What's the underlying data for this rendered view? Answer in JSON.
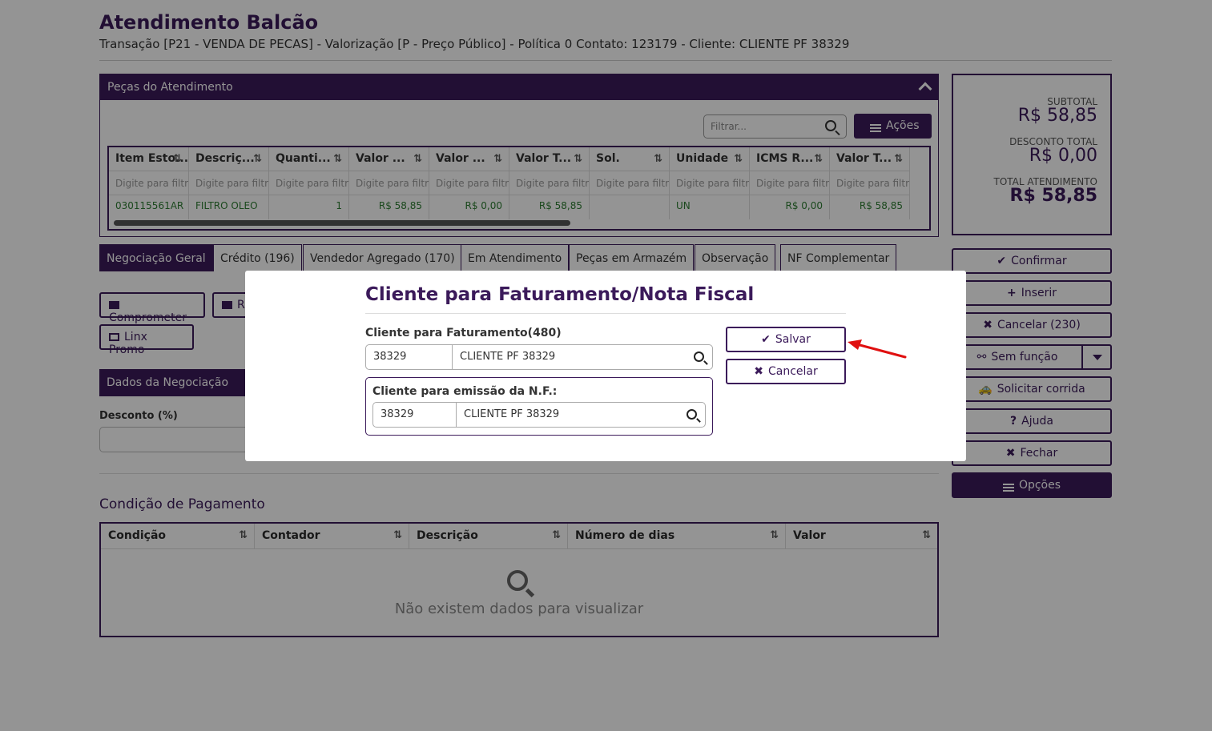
{
  "header": {
    "title": "Atendimento Balcão",
    "subtitle": "Transação [P21 - VENDA DE PECAS] - Valorização [P - Preço Público] - Política 0 Contato: 123179 - Cliente: CLIENTE PF 38329"
  },
  "parts": {
    "title": "Peças do Atendimento",
    "filter_placeholder": "Filtrar...",
    "actions_label": "Ações",
    "columns": [
      "Item Esto...",
      "Descriç...",
      "Quanti...",
      "Valor ...",
      "Valor ...",
      "Valor T...",
      "Sol.",
      "Unidade",
      "ICMS R...",
      "Valor T..."
    ],
    "filter_hints": [
      "Digite para filtrar...",
      "Digite para filtr",
      "Digite para filtr",
      "Digite para filtr",
      "Digite para filtr",
      "Digite para filtr",
      "Digite para filtr",
      "Digite para filtr",
      "Digite para filtr",
      "Digite para filtr"
    ],
    "rows": [
      [
        "030115561AR",
        "FILTRO OLEO",
        "1",
        "R$ 58,85",
        "R$ 0,00",
        "R$ 58,85",
        "",
        "UN",
        "R$ 0,00",
        "R$ 58,85"
      ]
    ]
  },
  "tabs": [
    "Negociação Geral",
    "Crédito (196)",
    "Vendedor Agregado (170)",
    "Em Atendimento",
    "Peças em Armazém",
    "Observação",
    "NF Complementar"
  ],
  "negotiation": {
    "comprometer": "Comprometer",
    "r_button": "R",
    "linx_promo": "Linx Promo",
    "section": "Dados da Negociação",
    "discount_label": "Desconto (%)"
  },
  "payment": {
    "title": "Condição de Pagamento",
    "columns": [
      "Condição",
      "Contador",
      "Descrição",
      "Número de dias",
      "Valor"
    ],
    "empty": "Não existem dados para visualizar"
  },
  "totals": {
    "subtotal_label": "SUBTOTAL",
    "subtotal": "R$ 58,85",
    "discount_label": "DESCONTO TOTAL",
    "discount": "R$ 0,00",
    "total_label": "TOTAL ATENDIMENTO",
    "total": "R$ 58,85"
  },
  "side_buttons": {
    "confirmar": "Confirmar",
    "inserir": "Inserir",
    "cancelar": "Cancelar (230)",
    "sem_funcao": "Sem função",
    "solicitar": "Solicitar corrida",
    "ajuda": "Ajuda",
    "fechar": "Fechar",
    "opcoes": "Opções"
  },
  "modal": {
    "title": "Cliente para Faturamento/Nota Fiscal",
    "billing_label": "Cliente para Faturamento(480)",
    "billing_code": "38329",
    "billing_name": "CLIENTE PF 38329",
    "nf_label": "Cliente para emissão da N.F.:",
    "nf_code": "38329",
    "nf_name": "CLIENTE PF 38329",
    "save": "Salvar",
    "cancel": "Cancelar"
  },
  "colors": {
    "brand": "#3b1a5a",
    "value_green": "#2e7d32",
    "arrow": "#e01010"
  }
}
